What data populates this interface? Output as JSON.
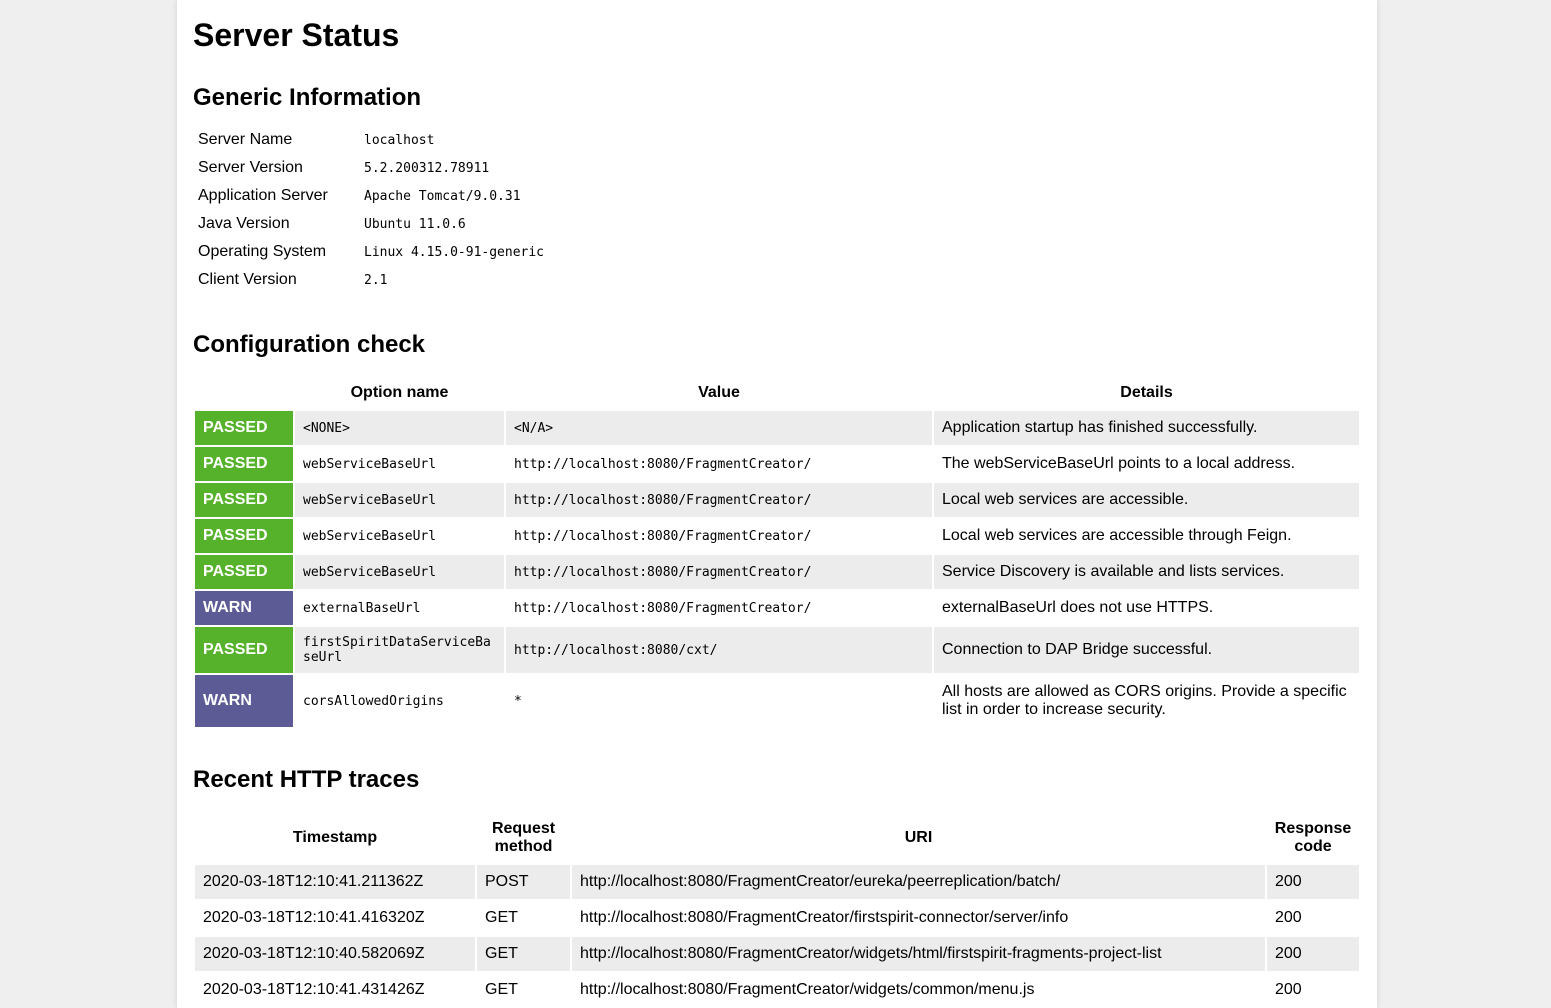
{
  "title": "Server Status",
  "generic": {
    "heading": "Generic Information",
    "rows": [
      {
        "key": "Server Name",
        "value": "localhost"
      },
      {
        "key": "Server Version",
        "value": "5.2.200312.78911"
      },
      {
        "key": "Application Server",
        "value": "Apache Tomcat/9.0.31"
      },
      {
        "key": "Java Version",
        "value": "Ubuntu 11.0.6"
      },
      {
        "key": "Operating System",
        "value": "Linux 4.15.0-91-generic"
      },
      {
        "key": "Client Version",
        "value": "2.1"
      }
    ]
  },
  "config": {
    "heading": "Configuration check",
    "columns": {
      "status": "",
      "option": "Option name",
      "value": "Value",
      "details": "Details"
    },
    "rows": [
      {
        "status": "PASSED",
        "option": "<NONE>",
        "value": "<N/A>",
        "details": "Application startup has finished successfully."
      },
      {
        "status": "PASSED",
        "option": "webServiceBaseUrl",
        "value": "http://localhost:8080/FragmentCreator/",
        "details": "The webServiceBaseUrl points to a local address."
      },
      {
        "status": "PASSED",
        "option": "webServiceBaseUrl",
        "value": "http://localhost:8080/FragmentCreator/",
        "details": "Local web services are accessible."
      },
      {
        "status": "PASSED",
        "option": "webServiceBaseUrl",
        "value": "http://localhost:8080/FragmentCreator/",
        "details": "Local web services are accessible through Feign."
      },
      {
        "status": "PASSED",
        "option": "webServiceBaseUrl",
        "value": "http://localhost:8080/FragmentCreator/",
        "details": "Service Discovery is available and lists services."
      },
      {
        "status": "WARN",
        "option": "externalBaseUrl",
        "value": "http://localhost:8080/FragmentCreator/",
        "details": "externalBaseUrl does not use HTTPS."
      },
      {
        "status": "PASSED",
        "option": "firstSpiritDataServiceBaseUrl",
        "value": "http://localhost:8080/cxt/",
        "details": "Connection to DAP Bridge successful."
      },
      {
        "status": "WARN",
        "option": "corsAllowedOrigins",
        "value": "*",
        "details": "All hosts are allowed as CORS origins. Provide a specific list in order to increase security."
      }
    ]
  },
  "traces": {
    "heading": "Recent HTTP traces",
    "columns": {
      "timestamp": "Timestamp",
      "method": "Request method",
      "uri": "URI",
      "code": "Response code"
    },
    "rows": [
      {
        "timestamp": "2020-03-18T12:10:41.211362Z",
        "method": "POST",
        "uri": "http://localhost:8080/FragmentCreator/eureka/peerreplication/batch/",
        "code": "200"
      },
      {
        "timestamp": "2020-03-18T12:10:41.416320Z",
        "method": "GET",
        "uri": "http://localhost:8080/FragmentCreator/firstspirit-connector/server/info",
        "code": "200"
      },
      {
        "timestamp": "2020-03-18T12:10:40.582069Z",
        "method": "GET",
        "uri": "http://localhost:8080/FragmentCreator/widgets/html/firstspirit-fragments-project-list",
        "code": "200"
      },
      {
        "timestamp": "2020-03-18T12:10:41.431426Z",
        "method": "GET",
        "uri": "http://localhost:8080/FragmentCreator/widgets/common/menu.js",
        "code": "200"
      }
    ]
  },
  "colors": {
    "passed": "#55b22a",
    "warn": "#5c5b96",
    "row_shade": "#ececec",
    "background": "#efefef"
  }
}
